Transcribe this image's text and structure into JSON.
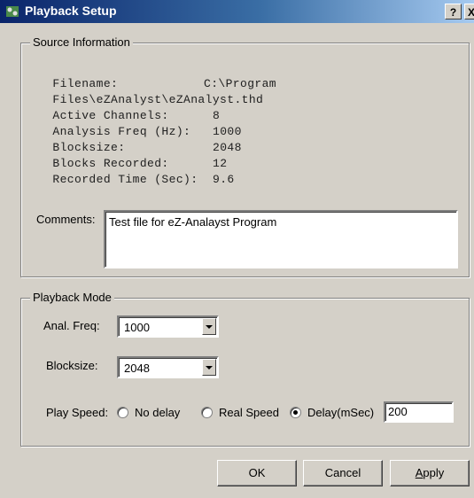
{
  "window": {
    "title": "Playback Setup",
    "help_label": "?",
    "close_label": "X"
  },
  "source_info": {
    "legend": "Source Information",
    "rows": [
      {
        "label": "Filename:",
        "value": "C:\\Program"
      },
      {
        "label": "Files\\eZAnalyst\\eZAnalyst.thd",
        "value": ""
      },
      {
        "label": "Active Channels:",
        "value": "8"
      },
      {
        "label": "Analysis Freq (Hz):",
        "value": "1000"
      },
      {
        "label": "Blocksize:",
        "value": "2048"
      },
      {
        "label": "Blocks Recorded:",
        "value": "12"
      },
      {
        "label": "Recorded Time (Sec):",
        "value": "9.6"
      }
    ],
    "comments_label": "Comments:",
    "comments_value": "Test file for eZ-Analayst Program"
  },
  "playback_mode": {
    "legend": "Playback Mode",
    "anal_freq_label": "Anal. Freq:",
    "anal_freq_value": "1000",
    "blocksize_label": "Blocksize:",
    "blocksize_value": "2048",
    "play_speed_label": "Play Speed:",
    "options": [
      "No delay",
      "Real Speed",
      "Delay(mSec)"
    ],
    "selected_option": "Delay(mSec)",
    "delay_value": "200"
  },
  "buttons": {
    "ok": "OK",
    "cancel": "Cancel",
    "apply_rest": "pply",
    "apply_accel": "A"
  }
}
